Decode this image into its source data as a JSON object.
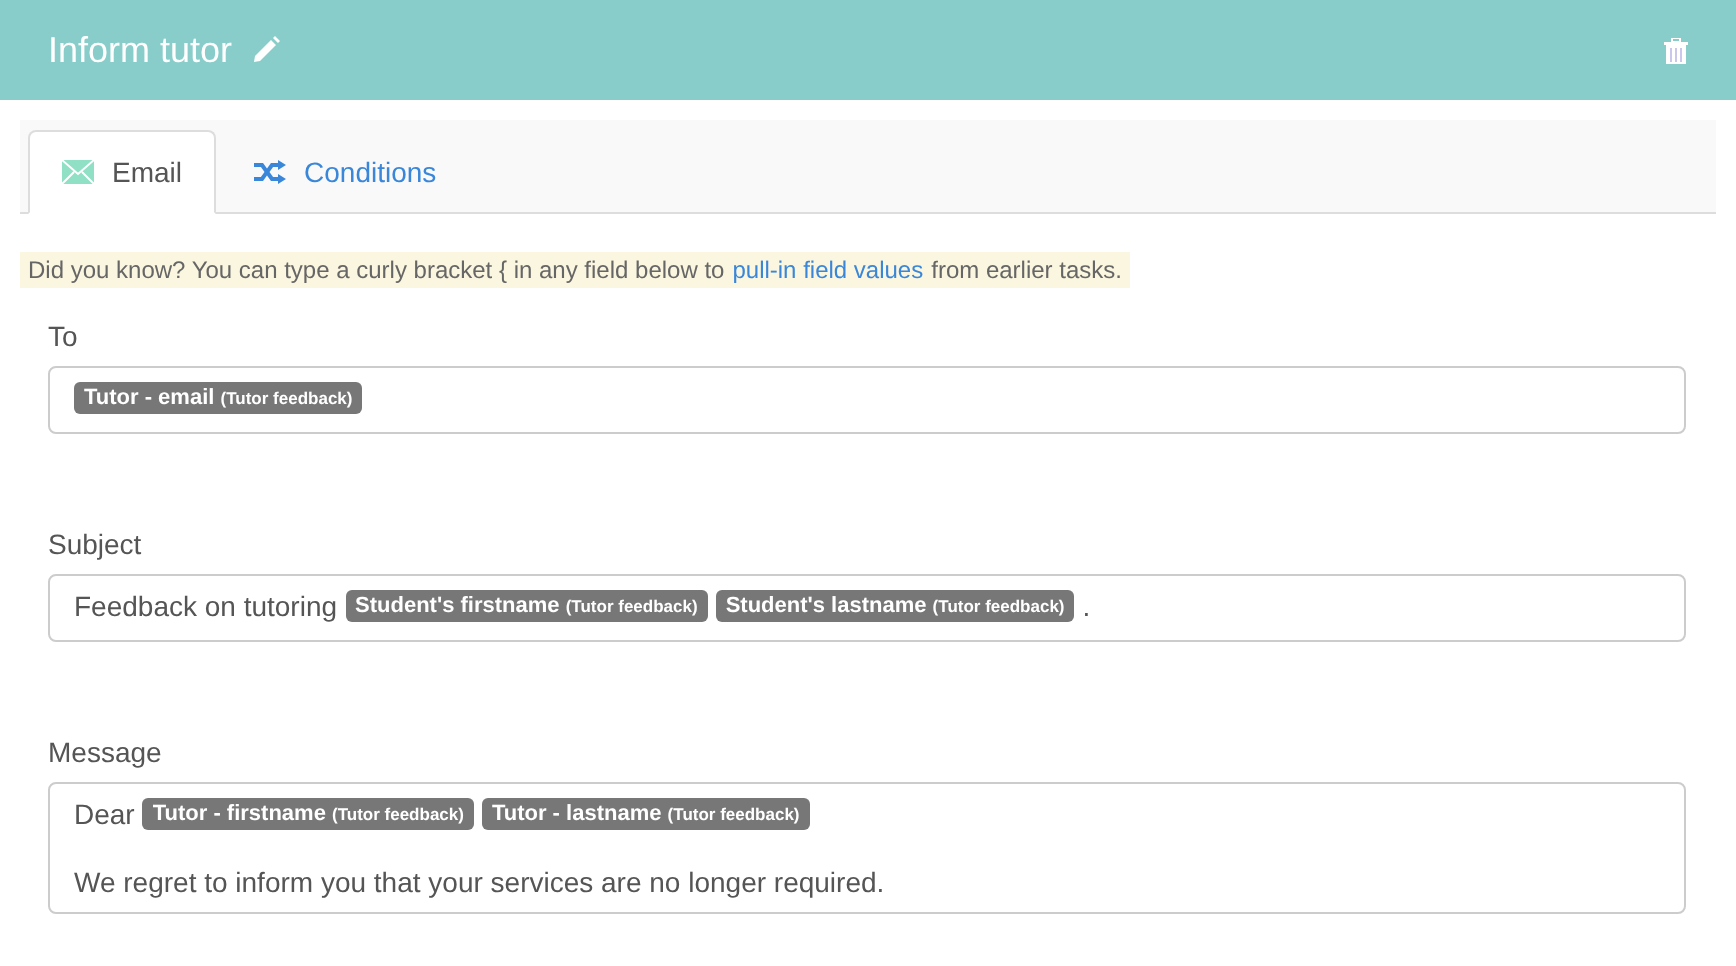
{
  "header": {
    "title": "Inform tutor"
  },
  "tabs": [
    {
      "label": "Email",
      "selected": true,
      "kind": "email"
    },
    {
      "label": "Conditions",
      "selected": false,
      "kind": "conditions"
    }
  ],
  "tip": {
    "before": "Did you know? You can type a curly bracket { in any field below to",
    "link": "pull-in field values",
    "after": "from earlier tasks."
  },
  "fields": [
    {
      "label": "To",
      "lines": [
        [
          {
            "kind": "token",
            "name": "Tutor - email",
            "source": "(Tutor feedback)"
          }
        ]
      ]
    },
    {
      "label": "Subject",
      "lines": [
        [
          {
            "kind": "text",
            "text": "Feedback on tutoring"
          },
          {
            "kind": "token",
            "name": "Student's firstname",
            "source": "(Tutor feedback)"
          },
          {
            "kind": "token",
            "name": "Student's lastname",
            "source": "(Tutor feedback)"
          },
          {
            "kind": "text",
            "text": "."
          }
        ]
      ]
    },
    {
      "label": "Message",
      "lines": [
        [
          {
            "kind": "text",
            "text": "Dear"
          },
          {
            "kind": "token",
            "name": "Tutor - firstname",
            "source": "(Tutor feedback)"
          },
          {
            "kind": "token",
            "name": "Tutor - lastname",
            "source": "(Tutor feedback)"
          }
        ],
        [
          {
            "kind": "text",
            "text": "We regret to inform you that your services are no longer required."
          }
        ]
      ]
    }
  ]
}
